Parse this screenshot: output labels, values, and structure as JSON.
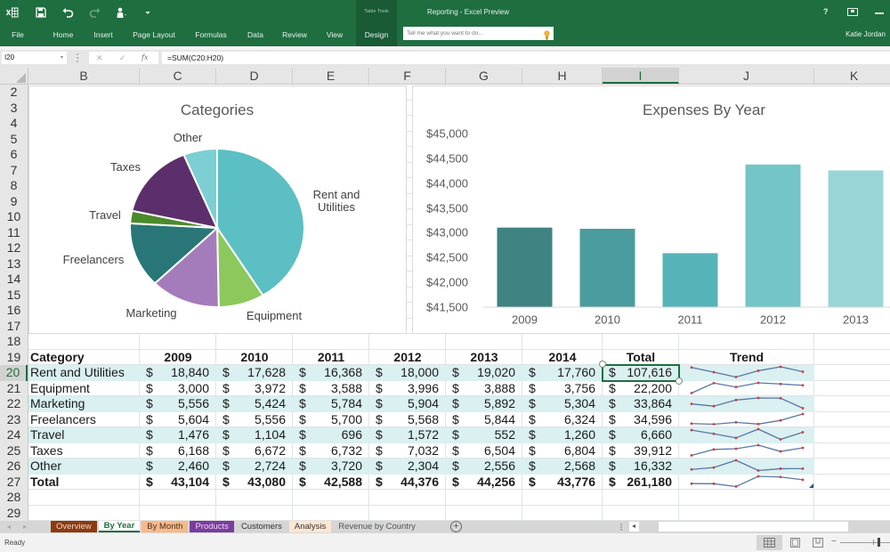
{
  "window": {
    "title": "Reporting - Excel Preview",
    "contextual_group": "Table Tools",
    "user_name": "Katie Jordan",
    "help_label": "?"
  },
  "ribbon": {
    "tabs": [
      "File",
      "Home",
      "Insert",
      "Page Layout",
      "Formulas",
      "Data",
      "Review",
      "View",
      "Design"
    ],
    "active_contextual_tab": "Design",
    "tell_me_placeholder": "Tell me what you want to do...",
    "color": "#1f6e40"
  },
  "formula_bar": {
    "name_box": "I20",
    "name_box_arrow": "▾",
    "cancel_glyph": "✕",
    "enter_glyph": "✓",
    "fx_label": "fx",
    "formula": "=SUM(C20:H20)"
  },
  "grid": {
    "columns": [
      "B",
      "C",
      "D",
      "E",
      "F",
      "G",
      "H",
      "I",
      "J",
      "K"
    ],
    "rows": [
      "2",
      "3",
      "4",
      "5",
      "6",
      "7",
      "8",
      "9",
      "10",
      "11",
      "12",
      "13",
      "14",
      "15",
      "16",
      "17",
      "18",
      "19",
      "20",
      "21",
      "22",
      "23",
      "24",
      "25",
      "26",
      "27",
      "28",
      "29"
    ],
    "selected_column": "I",
    "selected_row": "20",
    "active_cell": "I20"
  },
  "table": {
    "currency": "$",
    "headers": {
      "category": "Category",
      "years": [
        "2009",
        "2010",
        "2011",
        "2012",
        "2013",
        "2014"
      ],
      "total": "Total",
      "trend": "Trend"
    },
    "rows": [
      {
        "label": "Rent and Utilities",
        "values": [
          "18,840",
          "17,628",
          "16,368",
          "18,000",
          "19,020",
          "17,760"
        ],
        "total": "107,616"
      },
      {
        "label": "Equipment",
        "values": [
          "3,000",
          "3,972",
          "3,588",
          "3,996",
          "3,888",
          "3,756"
        ],
        "total": "22,200"
      },
      {
        "label": "Marketing",
        "values": [
          "5,556",
          "5,424",
          "5,784",
          "5,904",
          "5,892",
          "5,304"
        ],
        "total": "33,864"
      },
      {
        "label": "Freelancers",
        "values": [
          "5,604",
          "5,556",
          "5,700",
          "5,568",
          "5,844",
          "6,324"
        ],
        "total": "34,596"
      },
      {
        "label": "Travel",
        "values": [
          "1,476",
          "1,104",
          "696",
          "1,572",
          "552",
          "1,260"
        ],
        "total": "6,660"
      },
      {
        "label": "Taxes",
        "values": [
          "6,168",
          "6,672",
          "6,732",
          "7,032",
          "6,504",
          "6,804"
        ],
        "total": "39,912"
      },
      {
        "label": "Other",
        "values": [
          "2,460",
          "2,724",
          "3,720",
          "2,304",
          "2,556",
          "2,568"
        ],
        "total": "16,332"
      }
    ],
    "total_row": {
      "label": "Total",
      "values": [
        "43,104",
        "43,080",
        "42,588",
        "44,376",
        "44,256",
        "43,776"
      ],
      "total": "261,180"
    },
    "band_color": "#daf0f1",
    "sparkline_color": "#5878a8",
    "sparkline_marker_color": "#d23a3a"
  },
  "chart_data": [
    {
      "type": "pie",
      "title": "Categories",
      "categories": [
        "Rent and Utilities",
        "Equipment",
        "Marketing",
        "Freelancers",
        "Travel",
        "Taxes",
        "Other"
      ],
      "values": [
        107616,
        22200,
        33864,
        34596,
        6660,
        39912,
        16332
      ],
      "colors": [
        "#5bbfc3",
        "#8cc85b",
        "#a57cbb",
        "#287677",
        "#4b8b2b",
        "#5c2f6c",
        "#7ccfd2"
      ],
      "legend": "none",
      "data_labels": "category names outside slices"
    },
    {
      "type": "bar",
      "title": "Expenses By Year",
      "categories": [
        "2009",
        "2010",
        "2011",
        "2012",
        "2013"
      ],
      "values": [
        43104,
        43080,
        42588,
        44376,
        44256
      ],
      "colors": [
        "#3f8383",
        "#4b9c9f",
        "#56b4b8",
        "#73c5c8",
        "#99d5d7"
      ],
      "xlabel": "",
      "ylabel": "",
      "ylim": [
        41500,
        45000
      ],
      "yticks": [
        41500,
        42000,
        42500,
        43000,
        43500,
        44000,
        44500,
        45000
      ],
      "ytick_labels": [
        "$41,500",
        "$42,000",
        "$42,500",
        "$43,000",
        "$43,500",
        "$44,000",
        "$44,500",
        "$45,000"
      ],
      "grid": false,
      "legend": "none"
    }
  ],
  "sheet_tabs": {
    "nav_prev": "◂",
    "nav_next": "▸",
    "add_glyph": "+",
    "tabs": [
      {
        "label": "Overview",
        "bg": "#8b3a12",
        "fg": "#f5d8c4"
      },
      {
        "label": "By Year",
        "bg": "#ffffff",
        "fg": "#1f6e40",
        "active": true
      },
      {
        "label": "By Month",
        "bg": "#f8b98a",
        "fg": "#4a3220"
      },
      {
        "label": "Products",
        "bg": "#7a3d9c",
        "fg": "#ead6f4"
      },
      {
        "label": "Customers",
        "bg": "#d6d6d6",
        "fg": "#333333"
      },
      {
        "label": "Analysis",
        "bg": "#fde6d2",
        "fg": "#333333"
      },
      {
        "label": "Revenue by Country",
        "bg": "#d6d6d6",
        "fg": "#555555"
      }
    ]
  },
  "status_bar": {
    "status": "Ready",
    "active_view": "Normal",
    "zoom_out_glyph": "−"
  }
}
